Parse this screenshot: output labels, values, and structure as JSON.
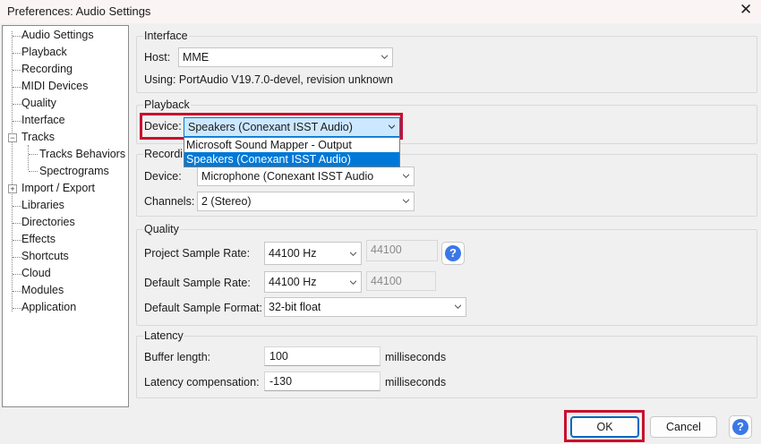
{
  "window": {
    "title": "Preferences: Audio Settings",
    "close_glyph": "✕"
  },
  "tree": {
    "items": [
      {
        "label": "Audio Settings"
      },
      {
        "label": "Playback"
      },
      {
        "label": "Recording"
      },
      {
        "label": "MIDI Devices"
      },
      {
        "label": "Quality"
      },
      {
        "label": "Interface"
      },
      {
        "label": "Tracks",
        "expander": "−"
      },
      {
        "label": "Tracks Behaviors"
      },
      {
        "label": "Spectrograms"
      },
      {
        "label": "Import / Export",
        "expander": "+"
      },
      {
        "label": "Libraries"
      },
      {
        "label": "Directories"
      },
      {
        "label": "Effects"
      },
      {
        "label": "Shortcuts"
      },
      {
        "label": "Cloud"
      },
      {
        "label": "Modules"
      },
      {
        "label": "Application"
      }
    ]
  },
  "interface": {
    "title": "Interface",
    "host_label": "Host:",
    "host_value": "MME",
    "using_text": "Using: PortAudio V19.7.0-devel, revision unknown"
  },
  "playback": {
    "title": "Playback",
    "device_label": "Device:",
    "device_value": "Speakers (Conexant ISST Audio)",
    "dropdown_options": [
      "Microsoft Sound Mapper - Output",
      "Speakers (Conexant ISST Audio)"
    ]
  },
  "recording": {
    "title": "Recordi",
    "device_label": "Device:",
    "device_value": "Microphone (Conexant ISST Audio",
    "channels_label": "Channels:",
    "channels_value": "2 (Stereo)"
  },
  "quality": {
    "title": "Quality",
    "project_rate_label": "Project Sample Rate:",
    "project_rate_value": "44100 Hz",
    "project_rate_text": "44100",
    "default_rate_label": "Default Sample Rate:",
    "default_rate_value": "44100 Hz",
    "default_rate_text": "44100",
    "format_label": "Default Sample Format:",
    "format_value": "32-bit float",
    "help_glyph": "?"
  },
  "latency": {
    "title": "Latency",
    "buffer_label": "Buffer length:",
    "buffer_value": "100",
    "buffer_unit": "milliseconds",
    "comp_label": "Latency compensation:",
    "comp_value": "-130",
    "comp_unit": "milliseconds"
  },
  "buttons": {
    "ok": "OK",
    "cancel": "Cancel",
    "help_glyph": "?"
  },
  "colors": {
    "highlight": "#0078d7",
    "annotation_red": "#c8102e",
    "help_blue": "#3b78e7"
  }
}
